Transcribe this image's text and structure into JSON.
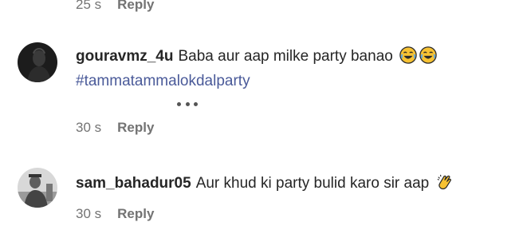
{
  "top_meta": {
    "time": "25 s",
    "reply": "Reply"
  },
  "comments": [
    {
      "username": "gouravmz_4u",
      "text": "Baba aur aap milke party banao",
      "emoji_icons": [
        "joy-emoji-icon",
        "joy-emoji-icon"
      ],
      "hashtag": "#tammatammalokdalparty",
      "time": "30 s",
      "reply": "Reply"
    },
    {
      "username": "sam_bahadur05",
      "text": "Aur khud ki party bulid karo sir aap",
      "emoji_icons": [
        "clapping-hands-emoji-icon"
      ],
      "time": "30 s",
      "reply": "Reply"
    }
  ],
  "more_icon": "more-horizontal-icon",
  "colors": {
    "text": "#262626",
    "meta": "#737373",
    "hashtag": "#4a5a99"
  }
}
